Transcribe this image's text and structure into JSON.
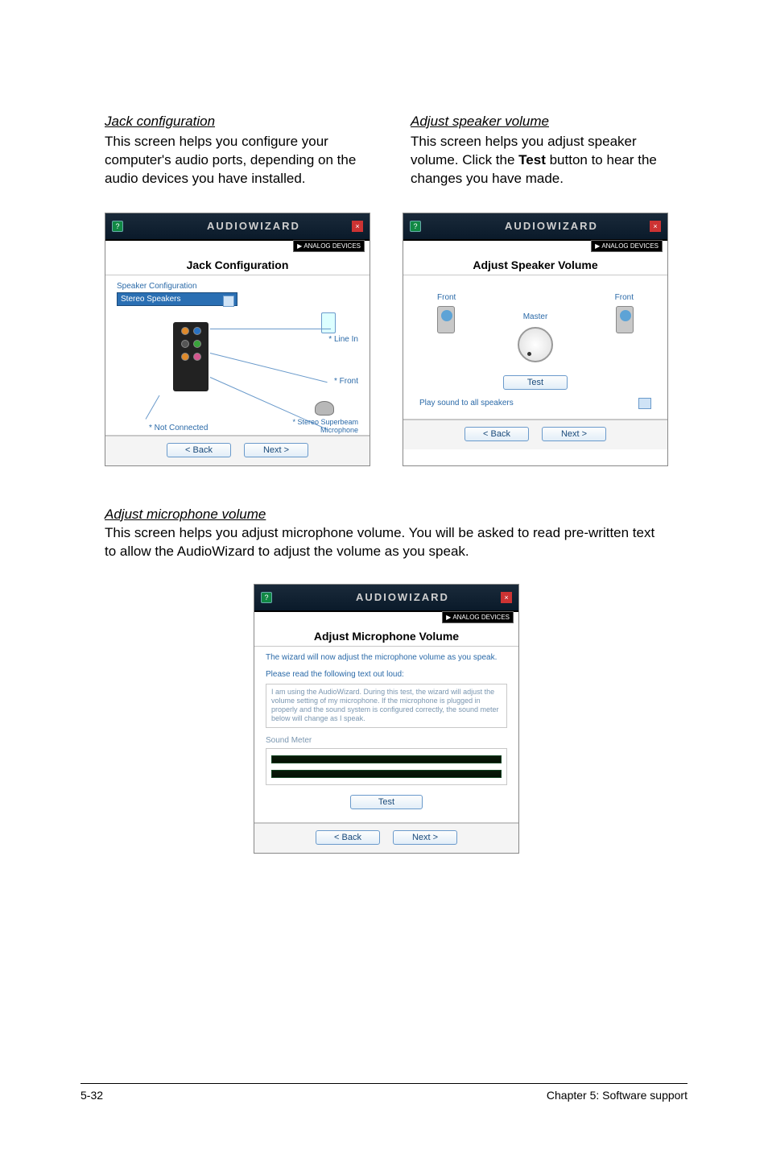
{
  "jack": {
    "heading": "Jack configuration",
    "body": "This screen helps you configure your computer's audio ports, depending on the audio devices you have installed."
  },
  "speaker": {
    "heading": "Adjust speaker volume",
    "body_pre": "This screen helps you adjust speaker volume. Click the ",
    "body_bold": "Test",
    "body_post": " button to hear the changes you have made."
  },
  "wiz_title": "AUDIOWIZARD",
  "brand": "ANALOG DEVICES",
  "play_glyph": "▶",
  "help_glyph": "?",
  "close_glyph": "×",
  "jack_panel": {
    "title": "Jack Configuration",
    "spk_cfg_label": "Speaker Configuration",
    "spk_cfg_value": "Stereo Speakers",
    "line_in": "* Line In",
    "front": "* Front",
    "mic": "* Stereo Superbeam Microphone",
    "not_connected": "* Not Connected"
  },
  "speaker_panel": {
    "title": "Adjust Speaker Volume",
    "front": "Front",
    "master": "Master",
    "test": "Test",
    "play_label": "Play sound to all speakers"
  },
  "nav": {
    "back": "< Back",
    "next": "Next >"
  },
  "mic": {
    "heading": "Adjust microphone volume",
    "body": "This screen helps you adjust microphone volume. You will be asked to read pre-written text to allow the AudioWizard to adjust the volume as you speak."
  },
  "mic_panel": {
    "title": "Adjust Microphone Volume",
    "instr": "The wizard will now adjust the microphone volume as you speak.",
    "read_label": "Please read the following text out loud:",
    "read_text": "I am using the AudioWizard. During this test, the wizard will adjust the volume setting of my microphone. If the microphone is plugged in properly and the sound system is configured correctly, the sound meter below will change as I speak.",
    "sound_meter": "Sound Meter",
    "test": "Test"
  },
  "footer": {
    "left": "5-32",
    "right": "Chapter 5: Software support"
  }
}
